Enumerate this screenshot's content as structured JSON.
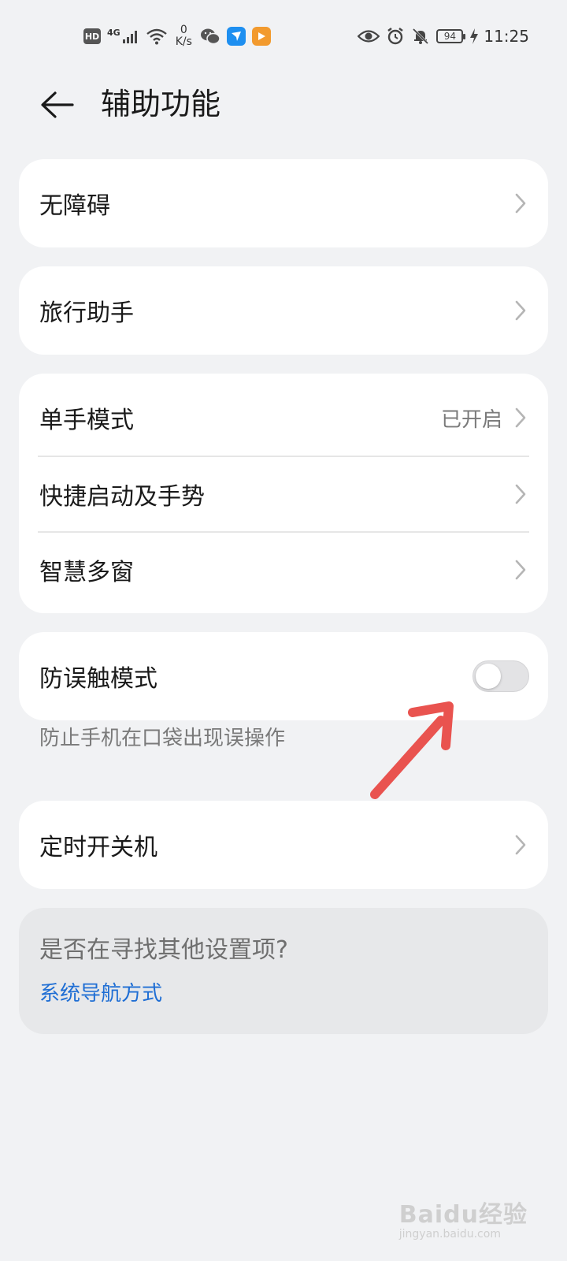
{
  "status_bar": {
    "hd": "HD",
    "network": "4G",
    "speed_value": "0",
    "speed_unit": "K/s",
    "battery": "94",
    "time": "11:25"
  },
  "header": {
    "title": "辅助功能"
  },
  "groups": {
    "accessibility": {
      "label": "无障碍"
    },
    "travel": {
      "label": "旅行助手"
    },
    "one_hand": {
      "label": "单手模式",
      "value": "已开启"
    },
    "shortcuts": {
      "label": "快捷启动及手势"
    },
    "multi_window": {
      "label": "智慧多窗"
    },
    "pocket_mode": {
      "label": "防误触模式",
      "enabled": false,
      "hint": "防止手机在口袋出现误操作"
    },
    "scheduled_power": {
      "label": "定时开关机"
    }
  },
  "suggest": {
    "question": "是否在寻找其他设置项?",
    "link": "系统导航方式"
  },
  "watermark": {
    "main": "Baidu经验",
    "sub": "jingyan.baidu.com"
  },
  "colors": {
    "background": "#f1f2f4",
    "card": "#ffffff",
    "link": "#1f6ed4",
    "annotation_arrow": "#e9534f"
  }
}
